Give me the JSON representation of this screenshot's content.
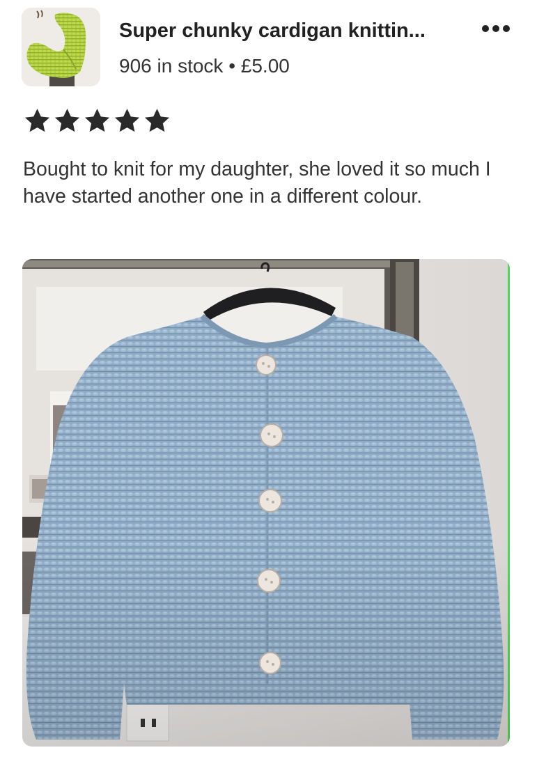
{
  "listing": {
    "title": "Super chunky cardigan knittin...",
    "stock_line": "906 in stock • £5.00",
    "thumbnail_icon": "knitted-scarf-thumbnail",
    "thumbnail_color": "#a8c83a"
  },
  "actions": {
    "more_icon": "more-horizontal-icon"
  },
  "review": {
    "rating": 5,
    "max_rating": 5,
    "star_color": "#2a2a2a",
    "text": "Bought to knit for my daughter, she loved it so much I have started another one in a different colour.",
    "photo": {
      "subject": "light-blue-chunky-knit-cardigan",
      "garment_color": "#8eaac4"
    }
  }
}
